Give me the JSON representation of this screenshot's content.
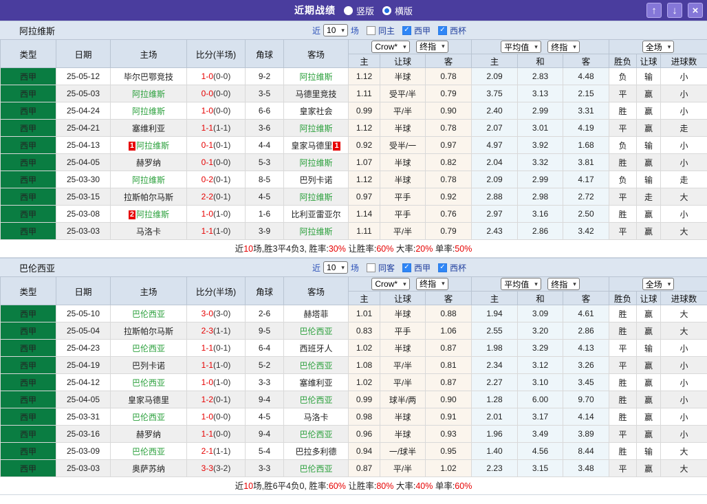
{
  "icons": {
    "check": "✓",
    "caret": "▾",
    "up": "↑",
    "down": "↓",
    "close": "×"
  },
  "colors": {
    "titlebar": "#4a3d9e",
    "button": "#8577d8",
    "header_bg": "#d8e2ee",
    "section_bg": "#dde6f1",
    "league_green": "#0a7d42",
    "team_green": "#2ba03c",
    "score_red": "#e60000",
    "win_red": "#e60000",
    "draw_green": "#22a12f",
    "lose_blue": "#3333cc",
    "asia_col_bg": "#fbf5ed",
    "euro_col_bg": "#eef6fa",
    "checkbox_blue": "#2f86f6"
  },
  "titlebar": {
    "title": "近期战绩",
    "radios": [
      {
        "label": "竖版",
        "selected": false
      },
      {
        "label": "横版",
        "selected": true
      }
    ]
  },
  "headers": {
    "left": [
      "类型",
      "日期",
      "主场",
      "比分(半场)",
      "角球",
      "客场"
    ],
    "sub": [
      "主",
      "让球",
      "客",
      "主",
      "和",
      "客",
      "胜负",
      "让球",
      "进球数"
    ],
    "selects": {
      "asia_source": "Crow*",
      "asia_time": "终指",
      "euro_source": "平均值",
      "euro_time": "终指",
      "scope": "全场"
    }
  },
  "sections": [
    {
      "team": "阿拉维斯",
      "filter": {
        "prefix": "近",
        "count": "10",
        "suffix": "场",
        "same_label": "同主",
        "same_checked": false,
        "league_label": "西甲",
        "league_checked": true,
        "cup_label": "西杯",
        "cup_checked": true
      },
      "rows": [
        {
          "type": "西甲",
          "date": "25-05-12",
          "home": "毕尔巴鄂竞技",
          "hb": "",
          "hg": false,
          "score": "1-0",
          "half": "(0-0)",
          "corner": "9-2",
          "away": "阿拉维斯",
          "ab": "",
          "ag": true,
          "asia": [
            "1.12",
            "半球",
            "0.78"
          ],
          "euro": [
            "2.09",
            "2.83",
            "4.48"
          ],
          "res": [
            [
              "负",
              "b"
            ],
            [
              "输",
              "b"
            ],
            [
              "小",
              "b"
            ]
          ]
        },
        {
          "type": "西甲",
          "date": "25-05-03",
          "home": "阿拉维斯",
          "hb": "",
          "hg": true,
          "score": "0-0",
          "half": "(0-0)",
          "corner": "3-5",
          "away": "马德里竞技",
          "ab": "",
          "ag": false,
          "asia": [
            "1.11",
            "受平/半",
            "0.79"
          ],
          "euro": [
            "3.75",
            "3.13",
            "2.15"
          ],
          "res": [
            [
              "平",
              "g"
            ],
            [
              "赢",
              "r"
            ],
            [
              "小",
              "b"
            ]
          ]
        },
        {
          "type": "西甲",
          "date": "25-04-24",
          "home": "阿拉维斯",
          "hb": "",
          "hg": true,
          "score": "1-0",
          "half": "(0-0)",
          "corner": "6-6",
          "away": "皇家社会",
          "ab": "",
          "ag": false,
          "asia": [
            "0.99",
            "平/半",
            "0.90"
          ],
          "euro": [
            "2.40",
            "2.99",
            "3.31"
          ],
          "res": [
            [
              "胜",
              "r"
            ],
            [
              "赢",
              "r"
            ],
            [
              "小",
              "b"
            ]
          ]
        },
        {
          "type": "西甲",
          "date": "25-04-21",
          "home": "塞维利亚",
          "hb": "",
          "hg": false,
          "score": "1-1",
          "half": "(1-1)",
          "corner": "3-6",
          "away": "阿拉维斯",
          "ab": "",
          "ag": true,
          "asia": [
            "1.12",
            "半球",
            "0.78"
          ],
          "euro": [
            "2.07",
            "3.01",
            "4.19"
          ],
          "res": [
            [
              "平",
              "g"
            ],
            [
              "赢",
              "r"
            ],
            [
              "走",
              "g"
            ]
          ]
        },
        {
          "type": "西甲",
          "date": "25-04-13",
          "home": "阿拉维斯",
          "hb": "1",
          "hg": true,
          "score": "0-1",
          "half": "(0-1)",
          "corner": "4-4",
          "away": "皇家马德里",
          "ab": "1",
          "ag": false,
          "asia": [
            "0.92",
            "受半/一",
            "0.97"
          ],
          "euro": [
            "4.97",
            "3.92",
            "1.68"
          ],
          "res": [
            [
              "负",
              "b"
            ],
            [
              "输",
              "b"
            ],
            [
              "小",
              "b"
            ]
          ]
        },
        {
          "type": "西甲",
          "date": "25-04-05",
          "home": "赫罗纳",
          "hb": "",
          "hg": false,
          "score": "0-1",
          "half": "(0-0)",
          "corner": "5-3",
          "away": "阿拉维斯",
          "ab": "",
          "ag": true,
          "asia": [
            "1.07",
            "半球",
            "0.82"
          ],
          "euro": [
            "2.04",
            "3.32",
            "3.81"
          ],
          "res": [
            [
              "胜",
              "r"
            ],
            [
              "赢",
              "r"
            ],
            [
              "小",
              "b"
            ]
          ]
        },
        {
          "type": "西甲",
          "date": "25-03-30",
          "home": "阿拉维斯",
          "hb": "",
          "hg": true,
          "score": "0-2",
          "half": "(0-1)",
          "corner": "8-5",
          "away": "巴列卡诺",
          "ab": "",
          "ag": false,
          "asia": [
            "1.12",
            "半球",
            "0.78"
          ],
          "euro": [
            "2.09",
            "2.99",
            "4.17"
          ],
          "res": [
            [
              "负",
              "b"
            ],
            [
              "输",
              "b"
            ],
            [
              "走",
              "g"
            ]
          ]
        },
        {
          "type": "西甲",
          "date": "25-03-15",
          "home": "拉斯帕尔马斯",
          "hb": "",
          "hg": false,
          "score": "2-2",
          "half": "(0-1)",
          "corner": "4-5",
          "away": "阿拉维斯",
          "ab": "",
          "ag": true,
          "asia": [
            "0.97",
            "平手",
            "0.92"
          ],
          "euro": [
            "2.88",
            "2.98",
            "2.72"
          ],
          "res": [
            [
              "平",
              "g"
            ],
            [
              "走",
              "g"
            ],
            [
              "大",
              "r"
            ]
          ]
        },
        {
          "type": "西甲",
          "date": "25-03-08",
          "home": "阿拉维斯",
          "hb": "2",
          "hg": true,
          "score": "1-0",
          "half": "(1-0)",
          "corner": "1-6",
          "away": "比利亚雷亚尔",
          "ab": "",
          "ag": false,
          "asia": [
            "1.14",
            "平手",
            "0.76"
          ],
          "euro": [
            "2.97",
            "3.16",
            "2.50"
          ],
          "res": [
            [
              "胜",
              "r"
            ],
            [
              "赢",
              "r"
            ],
            [
              "小",
              "b"
            ]
          ]
        },
        {
          "type": "西甲",
          "date": "25-03-03",
          "home": "马洛卡",
          "hb": "",
          "hg": false,
          "score": "1-1",
          "half": "(1-0)",
          "corner": "3-9",
          "away": "阿拉维斯",
          "ab": "",
          "ag": true,
          "asia": [
            "1.11",
            "平/半",
            "0.79"
          ],
          "euro": [
            "2.43",
            "2.86",
            "3.42"
          ],
          "res": [
            [
              "平",
              "g"
            ],
            [
              "赢",
              "r"
            ],
            [
              "大",
              "r"
            ]
          ]
        }
      ],
      "summary": [
        [
          "近",
          0
        ],
        [
          "10",
          1
        ],
        [
          "场,胜3平4负3, 胜率:",
          0
        ],
        [
          "30%",
          1
        ],
        [
          " 让胜率:",
          0
        ],
        [
          "60%",
          1
        ],
        [
          " 大率:",
          0
        ],
        [
          "20%",
          1
        ],
        [
          " 单率:",
          0
        ],
        [
          "50%",
          1
        ]
      ]
    },
    {
      "team": "巴伦西亚",
      "filter": {
        "prefix": "近",
        "count": "10",
        "suffix": "场",
        "same_label": "同客",
        "same_checked": false,
        "league_label": "西甲",
        "league_checked": true,
        "cup_label": "西杯",
        "cup_checked": true
      },
      "rows": [
        {
          "type": "西甲",
          "date": "25-05-10",
          "home": "巴伦西亚",
          "hb": "",
          "hg": true,
          "score": "3-0",
          "half": "(3-0)",
          "corner": "2-6",
          "away": "赫塔菲",
          "ab": "",
          "ag": false,
          "asia": [
            "1.01",
            "半球",
            "0.88"
          ],
          "euro": [
            "1.94",
            "3.09",
            "4.61"
          ],
          "res": [
            [
              "胜",
              "r"
            ],
            [
              "赢",
              "r"
            ],
            [
              "大",
              "r"
            ]
          ]
        },
        {
          "type": "西甲",
          "date": "25-05-04",
          "home": "拉斯帕尔马斯",
          "hb": "",
          "hg": false,
          "score": "2-3",
          "half": "(1-1)",
          "corner": "9-5",
          "away": "巴伦西亚",
          "ab": "",
          "ag": true,
          "asia": [
            "0.83",
            "平手",
            "1.06"
          ],
          "euro": [
            "2.55",
            "3.20",
            "2.86"
          ],
          "res": [
            [
              "胜",
              "r"
            ],
            [
              "赢",
              "r"
            ],
            [
              "大",
              "r"
            ]
          ]
        },
        {
          "type": "西甲",
          "date": "25-04-23",
          "home": "巴伦西亚",
          "hb": "",
          "hg": true,
          "score": "1-1",
          "half": "(0-1)",
          "corner": "6-4",
          "away": "西班牙人",
          "ab": "",
          "ag": false,
          "asia": [
            "1.02",
            "半球",
            "0.87"
          ],
          "euro": [
            "1.98",
            "3.29",
            "4.13"
          ],
          "res": [
            [
              "平",
              "g"
            ],
            [
              "输",
              "b"
            ],
            [
              "小",
              "b"
            ]
          ]
        },
        {
          "type": "西甲",
          "date": "25-04-19",
          "home": "巴列卡诺",
          "hb": "",
          "hg": false,
          "score": "1-1",
          "half": "(1-0)",
          "corner": "5-2",
          "away": "巴伦西亚",
          "ab": "",
          "ag": true,
          "asia": [
            "1.08",
            "平/半",
            "0.81"
          ],
          "euro": [
            "2.34",
            "3.12",
            "3.26"
          ],
          "res": [
            [
              "平",
              "g"
            ],
            [
              "赢",
              "r"
            ],
            [
              "小",
              "b"
            ]
          ]
        },
        {
          "type": "西甲",
          "date": "25-04-12",
          "home": "巴伦西亚",
          "hb": "",
          "hg": true,
          "score": "1-0",
          "half": "(1-0)",
          "corner": "3-3",
          "away": "塞维利亚",
          "ab": "",
          "ag": false,
          "asia": [
            "1.02",
            "平/半",
            "0.87"
          ],
          "euro": [
            "2.27",
            "3.10",
            "3.45"
          ],
          "res": [
            [
              "胜",
              "r"
            ],
            [
              "赢",
              "r"
            ],
            [
              "小",
              "b"
            ]
          ]
        },
        {
          "type": "西甲",
          "date": "25-04-05",
          "home": "皇家马德里",
          "hb": "",
          "hg": false,
          "score": "1-2",
          "half": "(0-1)",
          "corner": "9-4",
          "away": "巴伦西亚",
          "ab": "",
          "ag": true,
          "asia": [
            "0.99",
            "球半/两",
            "0.90"
          ],
          "euro": [
            "1.28",
            "6.00",
            "9.70"
          ],
          "res": [
            [
              "胜",
              "r"
            ],
            [
              "赢",
              "r"
            ],
            [
              "小",
              "b"
            ]
          ]
        },
        {
          "type": "西甲",
          "date": "25-03-31",
          "home": "巴伦西亚",
          "hb": "",
          "hg": true,
          "score": "1-0",
          "half": "(0-0)",
          "corner": "4-5",
          "away": "马洛卡",
          "ab": "",
          "ag": false,
          "asia": [
            "0.98",
            "半球",
            "0.91"
          ],
          "euro": [
            "2.01",
            "3.17",
            "4.14"
          ],
          "res": [
            [
              "胜",
              "r"
            ],
            [
              "赢",
              "r"
            ],
            [
              "小",
              "b"
            ]
          ]
        },
        {
          "type": "西甲",
          "date": "25-03-16",
          "home": "赫罗纳",
          "hb": "",
          "hg": false,
          "score": "1-1",
          "half": "(0-0)",
          "corner": "9-4",
          "away": "巴伦西亚",
          "ab": "",
          "ag": true,
          "asia": [
            "0.96",
            "半球",
            "0.93"
          ],
          "euro": [
            "1.96",
            "3.49",
            "3.89"
          ],
          "res": [
            [
              "平",
              "g"
            ],
            [
              "赢",
              "r"
            ],
            [
              "小",
              "b"
            ]
          ]
        },
        {
          "type": "西甲",
          "date": "25-03-09",
          "home": "巴伦西亚",
          "hb": "",
          "hg": true,
          "score": "2-1",
          "half": "(1-1)",
          "corner": "5-4",
          "away": "巴拉多利德",
          "ab": "",
          "ag": false,
          "asia": [
            "0.94",
            "一/球半",
            "0.95"
          ],
          "euro": [
            "1.40",
            "4.56",
            "8.44"
          ],
          "res": [
            [
              "胜",
              "r"
            ],
            [
              "输",
              "b"
            ],
            [
              "大",
              "r"
            ]
          ]
        },
        {
          "type": "西甲",
          "date": "25-03-03",
          "home": "奥萨苏纳",
          "hb": "",
          "hg": false,
          "score": "3-3",
          "half": "(3-2)",
          "corner": "3-3",
          "away": "巴伦西亚",
          "ab": "",
          "ag": true,
          "asia": [
            "0.87",
            "平/半",
            "1.02"
          ],
          "euro": [
            "2.23",
            "3.15",
            "3.48"
          ],
          "res": [
            [
              "平",
              "g"
            ],
            [
              "赢",
              "r"
            ],
            [
              "大",
              "r"
            ]
          ]
        }
      ],
      "summary": [
        [
          "近",
          0
        ],
        [
          "10",
          1
        ],
        [
          "场,胜6平4负0, 胜率:",
          0
        ],
        [
          "60%",
          1
        ],
        [
          " 让胜率:",
          0
        ],
        [
          "80%",
          1
        ],
        [
          " 大率:",
          0
        ],
        [
          "40%",
          1
        ],
        [
          " 单率:",
          0
        ],
        [
          "60%",
          1
        ]
      ]
    }
  ]
}
